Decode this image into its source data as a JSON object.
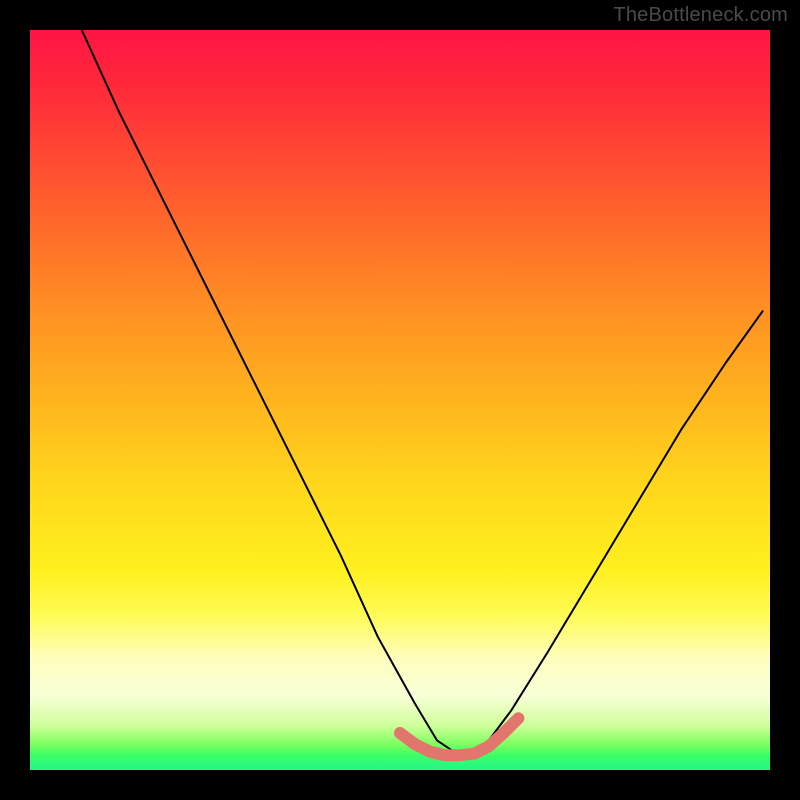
{
  "watermark": "TheBottleneck.com",
  "chart_data": {
    "type": "line",
    "title": "",
    "xlabel": "",
    "ylabel": "",
    "xlim": [
      0,
      100
    ],
    "ylim": [
      0,
      100
    ],
    "grid": false,
    "legend": false,
    "series": [
      {
        "name": "bottleneck-curve",
        "color": "#000000",
        "x": [
          7,
          12,
          18,
          24,
          30,
          36,
          42,
          47,
          52,
          55,
          58,
          60,
          62,
          65,
          70,
          76,
          82,
          88,
          94,
          99
        ],
        "y": [
          100,
          89,
          77,
          65,
          53,
          41,
          29,
          18,
          9,
          4,
          2,
          2,
          4,
          8,
          16,
          26,
          36,
          46,
          55,
          62
        ]
      },
      {
        "name": "bottleneck-valley-indicator",
        "color": "#e2766d",
        "x": [
          50,
          52,
          54,
          56,
          58,
          60,
          62,
          64,
          66
        ],
        "y": [
          5,
          3.5,
          2.5,
          2,
          2,
          2.2,
          3.2,
          5,
          7
        ]
      }
    ],
    "background_gradient": {
      "stops": [
        {
          "pct": 0,
          "color": "#ff1444"
        },
        {
          "pct": 22,
          "color": "#ff5a2e"
        },
        {
          "pct": 50,
          "color": "#ffb41e"
        },
        {
          "pct": 73,
          "color": "#fff01f"
        },
        {
          "pct": 90,
          "color": "#f8ffd6"
        },
        {
          "pct": 98,
          "color": "#3cff66"
        },
        {
          "pct": 100,
          "color": "#23f58a"
        }
      ]
    }
  }
}
